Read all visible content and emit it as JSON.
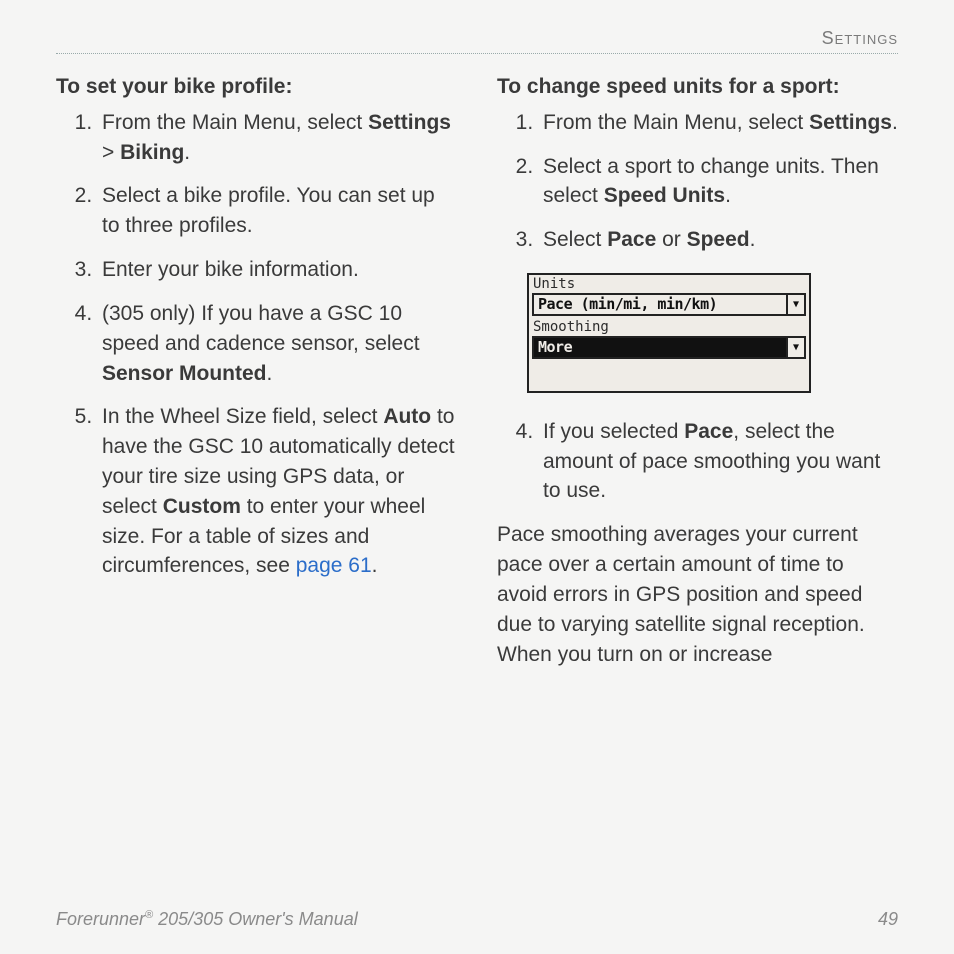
{
  "header": {
    "section": "Settings"
  },
  "left": {
    "title": "To set your bike profile:",
    "steps": [
      {
        "pre": "From the Main Menu, select ",
        "b1": "Settings",
        "mid": " > ",
        "b2": "Biking",
        "post": "."
      },
      {
        "text": "Select a bike profile. You can set up to three profiles."
      },
      {
        "text": "Enter your bike information."
      },
      {
        "pre": "(305 only) If you have a GSC 10 speed and cadence sensor, select ",
        "b1": "Sensor Mounted",
        "post": "."
      },
      {
        "pre": "In the Wheel Size field, select ",
        "b1": "Auto",
        "mid": " to have the GSC 10 automatically detect your tire size using GPS data, or select ",
        "b2": "Custom",
        "post2": " to enter your wheel size. For a table of sizes and circumferences, see ",
        "link": "page 61",
        "end": "."
      }
    ]
  },
  "right": {
    "title": "To change speed units for a sport:",
    "steps_a": [
      {
        "pre": "From the Main Menu, select ",
        "b1": "Settings",
        "post": "."
      },
      {
        "pre": "Select a sport to change units. Then select ",
        "b1": "Speed Units",
        "post": "."
      },
      {
        "pre": "Select ",
        "b1": "Pace",
        "mid": " or ",
        "b2": "Speed",
        "post": "."
      }
    ],
    "lcd": {
      "units_label": "Units",
      "units_value": "Pace (min/mi, min/km)",
      "smoothing_label": "Smoothing",
      "smoothing_value": "More"
    },
    "steps_b": [
      {
        "pre": "If you selected ",
        "b1": "Pace",
        "post": ", select the amount of pace smoothing you want to use."
      }
    ],
    "para": "Pace smoothing averages your current pace over a certain amount of time to avoid errors in GPS position and speed due to varying satellite signal reception. When you turn on or increase"
  },
  "footer": {
    "product_a": "Forerunner",
    "reg": "®",
    "product_b": " 205/305 Owner's Manual",
    "page": "49"
  }
}
